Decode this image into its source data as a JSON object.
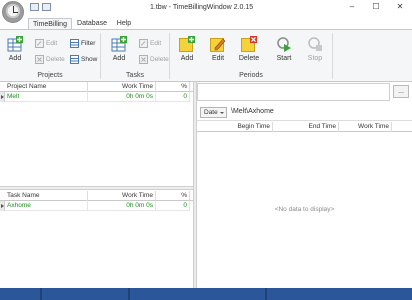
{
  "window": {
    "title": "1.tbw - TimeBillingWindow 2.0.15",
    "minimize_glyph": "–",
    "maximize_glyph": "☐",
    "close_glyph": "✕"
  },
  "tabs": [
    {
      "label": "TimeBilling",
      "active": true
    },
    {
      "label": "Database",
      "active": false
    },
    {
      "label": "Help",
      "active": false
    }
  ],
  "ribbon": {
    "projects": {
      "group_label": "Projects",
      "add_label": "Add",
      "edit_label": "Edit",
      "delete_label": "Delete",
      "filter_label": "Filter",
      "show_label": "Show"
    },
    "tasks": {
      "group_label": "Tasks",
      "add_label": "Add",
      "edit_label": "Edit",
      "delete_label": "Delete"
    },
    "periods": {
      "group_label": "Periods",
      "add_label": "Add",
      "edit_label": "Edit",
      "delete_label": "Delete",
      "start_label": "Start",
      "stop_label": "Stop"
    }
  },
  "projects_grid": {
    "columns": [
      "Project Name",
      "Work Time",
      "%"
    ],
    "rows": [
      {
        "name": "Melt",
        "work_time": "0h 0m 0s",
        "percent": "0"
      }
    ]
  },
  "tasks_grid": {
    "columns": [
      "Task Name",
      "Work Time",
      "%"
    ],
    "rows": [
      {
        "name": "Axhome",
        "work_time": "0h 0m 0s",
        "percent": "0"
      }
    ]
  },
  "periods_view": {
    "more_button": "...",
    "date_button": "Date",
    "path": "\\Melt\\Axhome",
    "columns": [
      "Begin Time",
      "End Time",
      "Work Time"
    ],
    "empty_text": "<No data to display>"
  },
  "colors": {
    "accent": "#2b579a",
    "positive": "#1a8f1a",
    "ribbon_bg": "#f5f6f7"
  }
}
